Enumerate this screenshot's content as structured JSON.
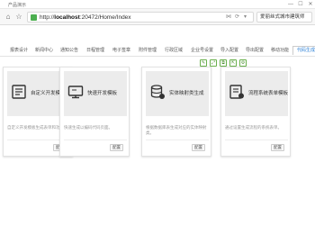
{
  "browser": {
    "tab_title": "产品演示",
    "url_prefix": "http://",
    "url_host": "localhost",
    "url_rest": ":20472/Home/Index",
    "search_text": "爱丽丝式城市建筑师",
    "minimize": "—",
    "maximize": "☐",
    "close": "✕",
    "back": "←",
    "forward": "→",
    "refresh": "⟳",
    "home": "⌂",
    "star": "☆",
    "menu_arrow": "▾"
  },
  "nav_tabs": [
    {
      "label": "报表设计"
    },
    {
      "label": "新闻中心"
    },
    {
      "label": "通知公告"
    },
    {
      "label": "日程管理"
    },
    {
      "label": "电子签章"
    },
    {
      "label": "附件管理"
    },
    {
      "label": "行政区域"
    },
    {
      "label": "企业号设置"
    },
    {
      "label": "导入配置"
    },
    {
      "label": "导出配置"
    },
    {
      "label": "移动功能"
    },
    {
      "label": "代码生成器",
      "active": true
    }
  ],
  "toolbar": {
    "icons": [
      "edit-icon",
      "fullscreen-icon",
      "copy-icon",
      "export-icon",
      "settings-icon"
    ],
    "glyphs": [
      "✎",
      "⤢",
      "⧉",
      "⇱",
      "⚙"
    ]
  },
  "cards": [
    {
      "title": "自定义开发模板",
      "desc": "自定义开发模板生成表单和功能数据",
      "button": "配置",
      "icon": "form-icon"
    },
    {
      "title": "快速开发模板",
      "desc": "快速生成以编码代码页面。",
      "button": "配置",
      "icon": "monitor-icon"
    },
    {
      "title": "实体映射类生成",
      "desc": "根据数据库表生成对应的实体映射类。",
      "button": "配置",
      "icon": "database-icon"
    },
    {
      "title": "流程系统表单模板",
      "desc": "通过设置生成流程的系统表单。",
      "button": "配置",
      "icon": "workflow-icon"
    }
  ],
  "colors": {
    "accent": "#2a7fd6",
    "tool_green": "#6ab04c",
    "card_header": "#ececec"
  }
}
